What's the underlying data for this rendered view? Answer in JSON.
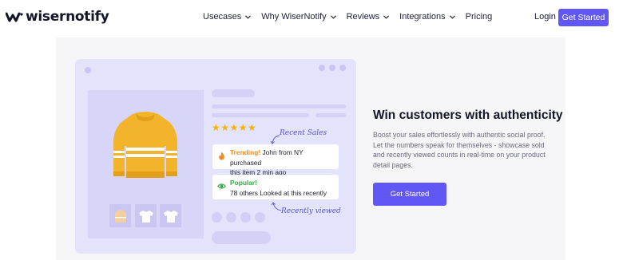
{
  "brand": {
    "name": "wisernotify",
    "accent": "#6157f5"
  },
  "nav": {
    "items": [
      {
        "label": "Usecases",
        "has_dropdown": true
      },
      {
        "label": "Why WiserNotify",
        "has_dropdown": true
      },
      {
        "label": "Reviews",
        "has_dropdown": true
      },
      {
        "label": "Integrations",
        "has_dropdown": true
      },
      {
        "label": "Pricing",
        "has_dropdown": false
      }
    ],
    "login_label": "Login",
    "cta_label": "Get Started"
  },
  "illustration": {
    "stars": "★★★★★",
    "annotation_recent_sales": "Recent Sales",
    "annotation_recently_viewed": "Recently viewed",
    "card_trending": {
      "tag": "Trending!",
      "line1_rest": " John from NY purchased",
      "line2": "this item 2 min ago",
      "tag_color": "#f08a1c"
    },
    "card_popular": {
      "tag": "Popular!",
      "line2": "78 others Looked at this recently",
      "tag_color": "#3aa547"
    }
  },
  "hero": {
    "title": "Win customers with authenticity",
    "body": "Boost your sales effortlessly with authentic social proof. Let the numbers speak for themselves - showcase sold and recently viewed counts in real-time on your product detail pages.",
    "cta_label": "Get Started"
  }
}
